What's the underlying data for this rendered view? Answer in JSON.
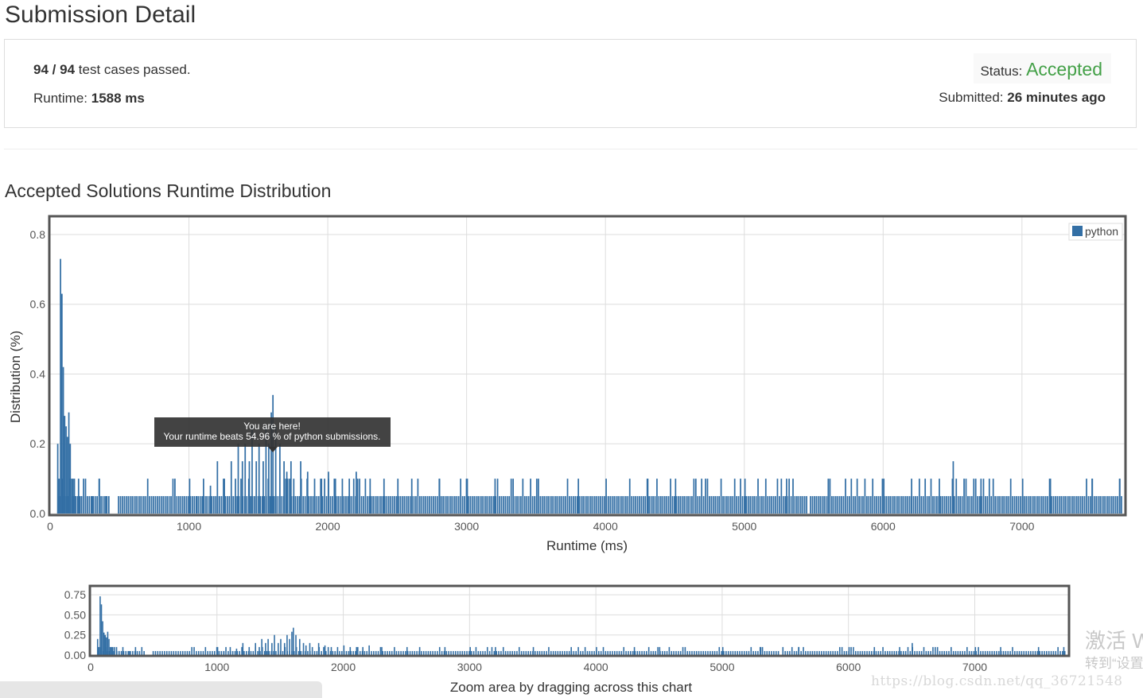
{
  "header": {
    "title": "Submission Detail"
  },
  "summary": {
    "passed": "94",
    "separator": "/",
    "total": "94",
    "passed_suffix": "test cases passed.",
    "runtime_label": "Runtime:",
    "runtime_value": "1588 ms",
    "status_label": "Status:",
    "status_value": "Accepted",
    "submitted_label": "Submitted:",
    "submitted_value": "26 minutes ago"
  },
  "distribution": {
    "title": "Accepted Solutions Runtime Distribution"
  },
  "colors": {
    "bar": "#336fa5",
    "accepted": "#43a047",
    "frame": "#555555"
  },
  "chart_data": [
    {
      "type": "bar",
      "xlabel": "Runtime (ms)",
      "ylabel": "Distribution (%)",
      "xlim": [
        0,
        7740
      ],
      "ylim": [
        0,
        0.85
      ],
      "x_ticks": [
        "0",
        "1000",
        "2000",
        "3000",
        "4000",
        "5000",
        "6000",
        "7000"
      ],
      "y_ticks": [
        "0.0",
        "0.2",
        "0.4",
        "0.6",
        "0.8"
      ],
      "grid": true,
      "legend_position": "top-right",
      "series": [
        {
          "name": "python",
          "x": [
            50,
            60,
            70,
            80,
            90,
            100,
            110,
            120,
            130,
            140,
            150,
            160,
            170,
            180,
            200,
            220,
            250,
            300,
            350,
            400,
            1000,
            1050,
            1100,
            1150,
            1200,
            1250,
            1300,
            1330,
            1350,
            1380,
            1400,
            1430,
            1450,
            1480,
            1500,
            1530,
            1550,
            1570,
            1588,
            1600,
            1620,
            1650,
            1680,
            1700,
            1730,
            1750,
            1800,
            1850,
            1900,
            1950,
            2000,
            2050,
            2100,
            2150,
            2200,
            2300,
            2400,
            2500,
            2600,
            2800,
            3000,
            3200,
            3500,
            3800,
            4000,
            4300,
            4500,
            5000,
            5300,
            5600,
            6000,
            6200,
            6400,
            6500,
            6700,
            7000,
            7200,
            7500,
            7700
          ],
          "values": [
            0.2,
            0.1,
            0.73,
            0.63,
            0.42,
            0.28,
            0.25,
            0.22,
            0.29,
            0.2,
            0.1,
            0.1,
            0.1,
            0.05,
            0.1,
            0.05,
            0.1,
            0.05,
            0.1,
            0.05,
            0.1,
            0.05,
            0.1,
            0.08,
            0.15,
            0.1,
            0.15,
            0.1,
            0.2,
            0.15,
            0.2,
            0.15,
            0.25,
            0.15,
            0.2,
            0.15,
            0.25,
            0.2,
            0.29,
            0.34,
            0.25,
            0.2,
            0.15,
            0.12,
            0.15,
            0.1,
            0.15,
            0.12,
            0.1,
            0.1,
            0.12,
            0.1,
            0.1,
            0.1,
            0.12,
            0.1,
            0.1,
            0.1,
            0.1,
            0.1,
            0.1,
            0.1,
            0.1,
            0.1,
            0.1,
            0.1,
            0.1,
            0.1,
            0.1,
            0.1,
            0.1,
            0.1,
            0.1,
            0.15,
            0.1,
            0.1,
            0.1,
            0.1,
            0.1
          ],
          "baseline": 0.05,
          "baseline_gaps": [
            [
              0,
              45
            ],
            [
              430,
              480
            ],
            [
              5450,
              5460
            ]
          ]
        }
      ],
      "annotation": {
        "x": 1588,
        "line1": "You are here!",
        "line2": "Your runtime beats 54.96 % of python submissions."
      }
    },
    {
      "type": "bar",
      "xlabel": "Zoom area by dragging across this chart",
      "xlim": [
        0,
        7740
      ],
      "ylim": [
        0,
        0.85
      ],
      "x_ticks": [
        "0",
        "1000",
        "2000",
        "3000",
        "4000",
        "5000",
        "6000",
        "7000"
      ],
      "y_ticks": [
        "0.00",
        "0.25",
        "0.50",
        "0.75"
      ],
      "grid": true
    }
  ],
  "watermarks": {
    "windows_line1": "激活 W",
    "windows_line2": "转到“设置",
    "blog": "https://blog.csdn.net/qq_36721548"
  }
}
